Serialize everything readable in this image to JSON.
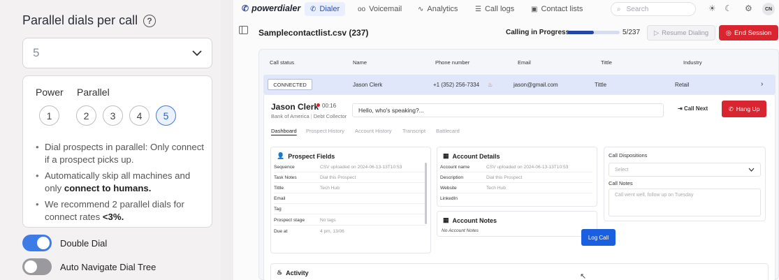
{
  "settings": {
    "title": "Parallel dials per call",
    "selected_value": "5",
    "power_label": "Power",
    "parallel_label": "Parallel",
    "options": [
      "1",
      "2",
      "3",
      "4",
      "5"
    ],
    "bullets": [
      {
        "text": "Dial prospects in parallel: Only connect if a prospect picks up.",
        "bold": ""
      },
      {
        "text": "Automatically skip all machines and only ",
        "bold": "connect to humans."
      },
      {
        "text": "We recommend 2 parallel dials for connect rates ",
        "bold": "<3%."
      }
    ],
    "toggles": [
      {
        "label": "Double Dial",
        "on": true
      },
      {
        "label": "Auto Navigate Dial Tree",
        "on": false
      }
    ]
  },
  "app": {
    "brand": "powerdialer",
    "nav": [
      {
        "label": "Dialer",
        "icon": "phone-icon",
        "active": true
      },
      {
        "label": "Voicemail",
        "icon": "voicemail-icon",
        "active": false
      },
      {
        "label": "Analytics",
        "icon": "analytics-icon",
        "active": false
      },
      {
        "label": "Call logs",
        "icon": "call-logs-icon",
        "active": false
      },
      {
        "label": "Contact lists",
        "icon": "contact-lists-icon",
        "active": false
      }
    ],
    "search_placeholder": "Search",
    "avatar": "CN",
    "list_title": "Samplecontactlist.csv  (237)",
    "calling_status": "Calling in Progress",
    "progress": {
      "current": 5,
      "total": 237,
      "label": "5/237",
      "fill_fraction": 0.5
    },
    "resume_label": "Resume Dialing",
    "end_label": "End Session",
    "columns": [
      "Call status",
      "Name",
      "Phone number",
      "Email",
      "Tittle",
      "Industry"
    ],
    "row": {
      "status": "CONNECTED",
      "name": "Jason Clerk",
      "phone": "+1 (352) 256-7334",
      "email": "jason@gmail.com",
      "title": "Tittle",
      "industry": "Retail"
    },
    "call": {
      "name": "Jason Clerk",
      "timer": "00:16",
      "company": "Bank of America",
      "role": "Debt Collector",
      "message": "Hello, who's speaking?...",
      "call_next": "Call Next",
      "hang_up": "Hang Up"
    },
    "sub_tabs": [
      "Dashboard",
      "Prospect History",
      "Account History",
      "Transcript",
      "Battlecard"
    ],
    "prospect_fields": {
      "title": "Prospect Fields",
      "rows": [
        {
          "k": "Sequence",
          "v": "CSV uploaded on 2024-06-13-13T10:53"
        },
        {
          "k": "Task Notes",
          "v": "Dial this Prospect"
        },
        {
          "k": "Tittle",
          "v": "Tech Hub"
        },
        {
          "k": "Email",
          "v": ""
        },
        {
          "k": "Tag",
          "v": ""
        },
        {
          "k": "Prospect stage",
          "v": "No tags"
        },
        {
          "k": "Due at",
          "v": "4 pm, 13/06"
        }
      ]
    },
    "account_details": {
      "title": "Account Details",
      "rows": [
        {
          "k": "Account name",
          "v": "CSV uploaded on 2024-06-13-13T10:53"
        },
        {
          "k": "Description",
          "v": "Dial this Prospect"
        },
        {
          "k": "Website",
          "v": "Tech Hub"
        },
        {
          "k": "LinkedIn",
          "v": ""
        }
      ]
    },
    "account_notes": {
      "title": "Account Notes",
      "empty": "No Account Notes"
    },
    "dispositions": {
      "label": "Call Dispositions",
      "select_placeholder": "Select",
      "notes_label": "Call Notes",
      "notes_placeholder": "Call went well, follow up on Tuesday",
      "log_call": "Log Call"
    },
    "activity_title": "Activity"
  }
}
